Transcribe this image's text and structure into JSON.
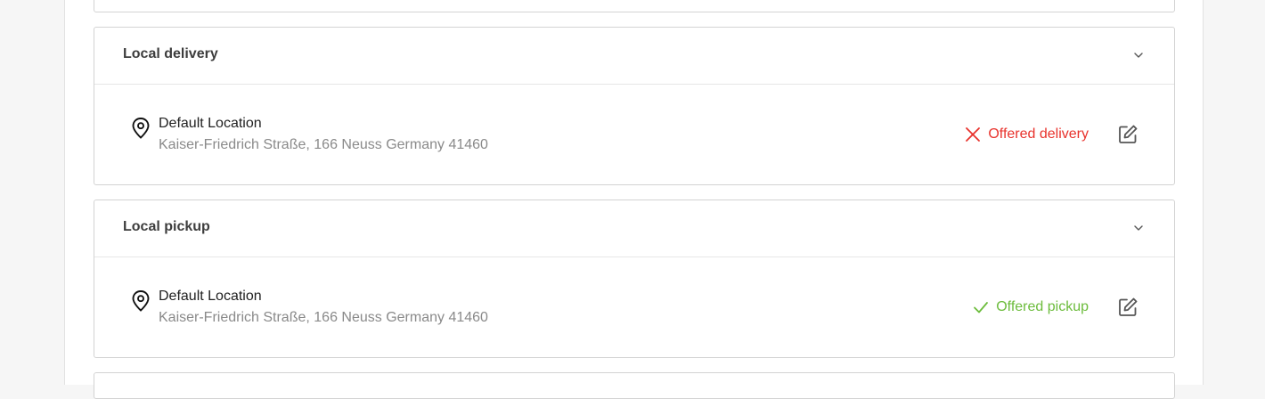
{
  "colors": {
    "delivery_status": "#e8322c",
    "pickup_status": "#6cbc3c",
    "title": "#3d3d3d",
    "address": "#8a8a8a"
  },
  "local_delivery": {
    "title": "Local delivery",
    "location_name": "Default Location",
    "address": "Kaiser-Friedrich Straße, 166 Neuss Germany 41460",
    "status_label": "Offered delivery",
    "status_icon": "x-icon",
    "edit_icon": "edit-icon",
    "collapse_icon": "chevron-down-icon",
    "location_icon": "map-pin-icon"
  },
  "local_pickup": {
    "title": "Local pickup",
    "location_name": "Default Location",
    "address": "Kaiser-Friedrich Straße, 166 Neuss Germany 41460",
    "status_label": "Offered pickup",
    "status_icon": "check-icon",
    "edit_icon": "edit-icon",
    "collapse_icon": "chevron-down-icon",
    "location_icon": "map-pin-icon"
  }
}
